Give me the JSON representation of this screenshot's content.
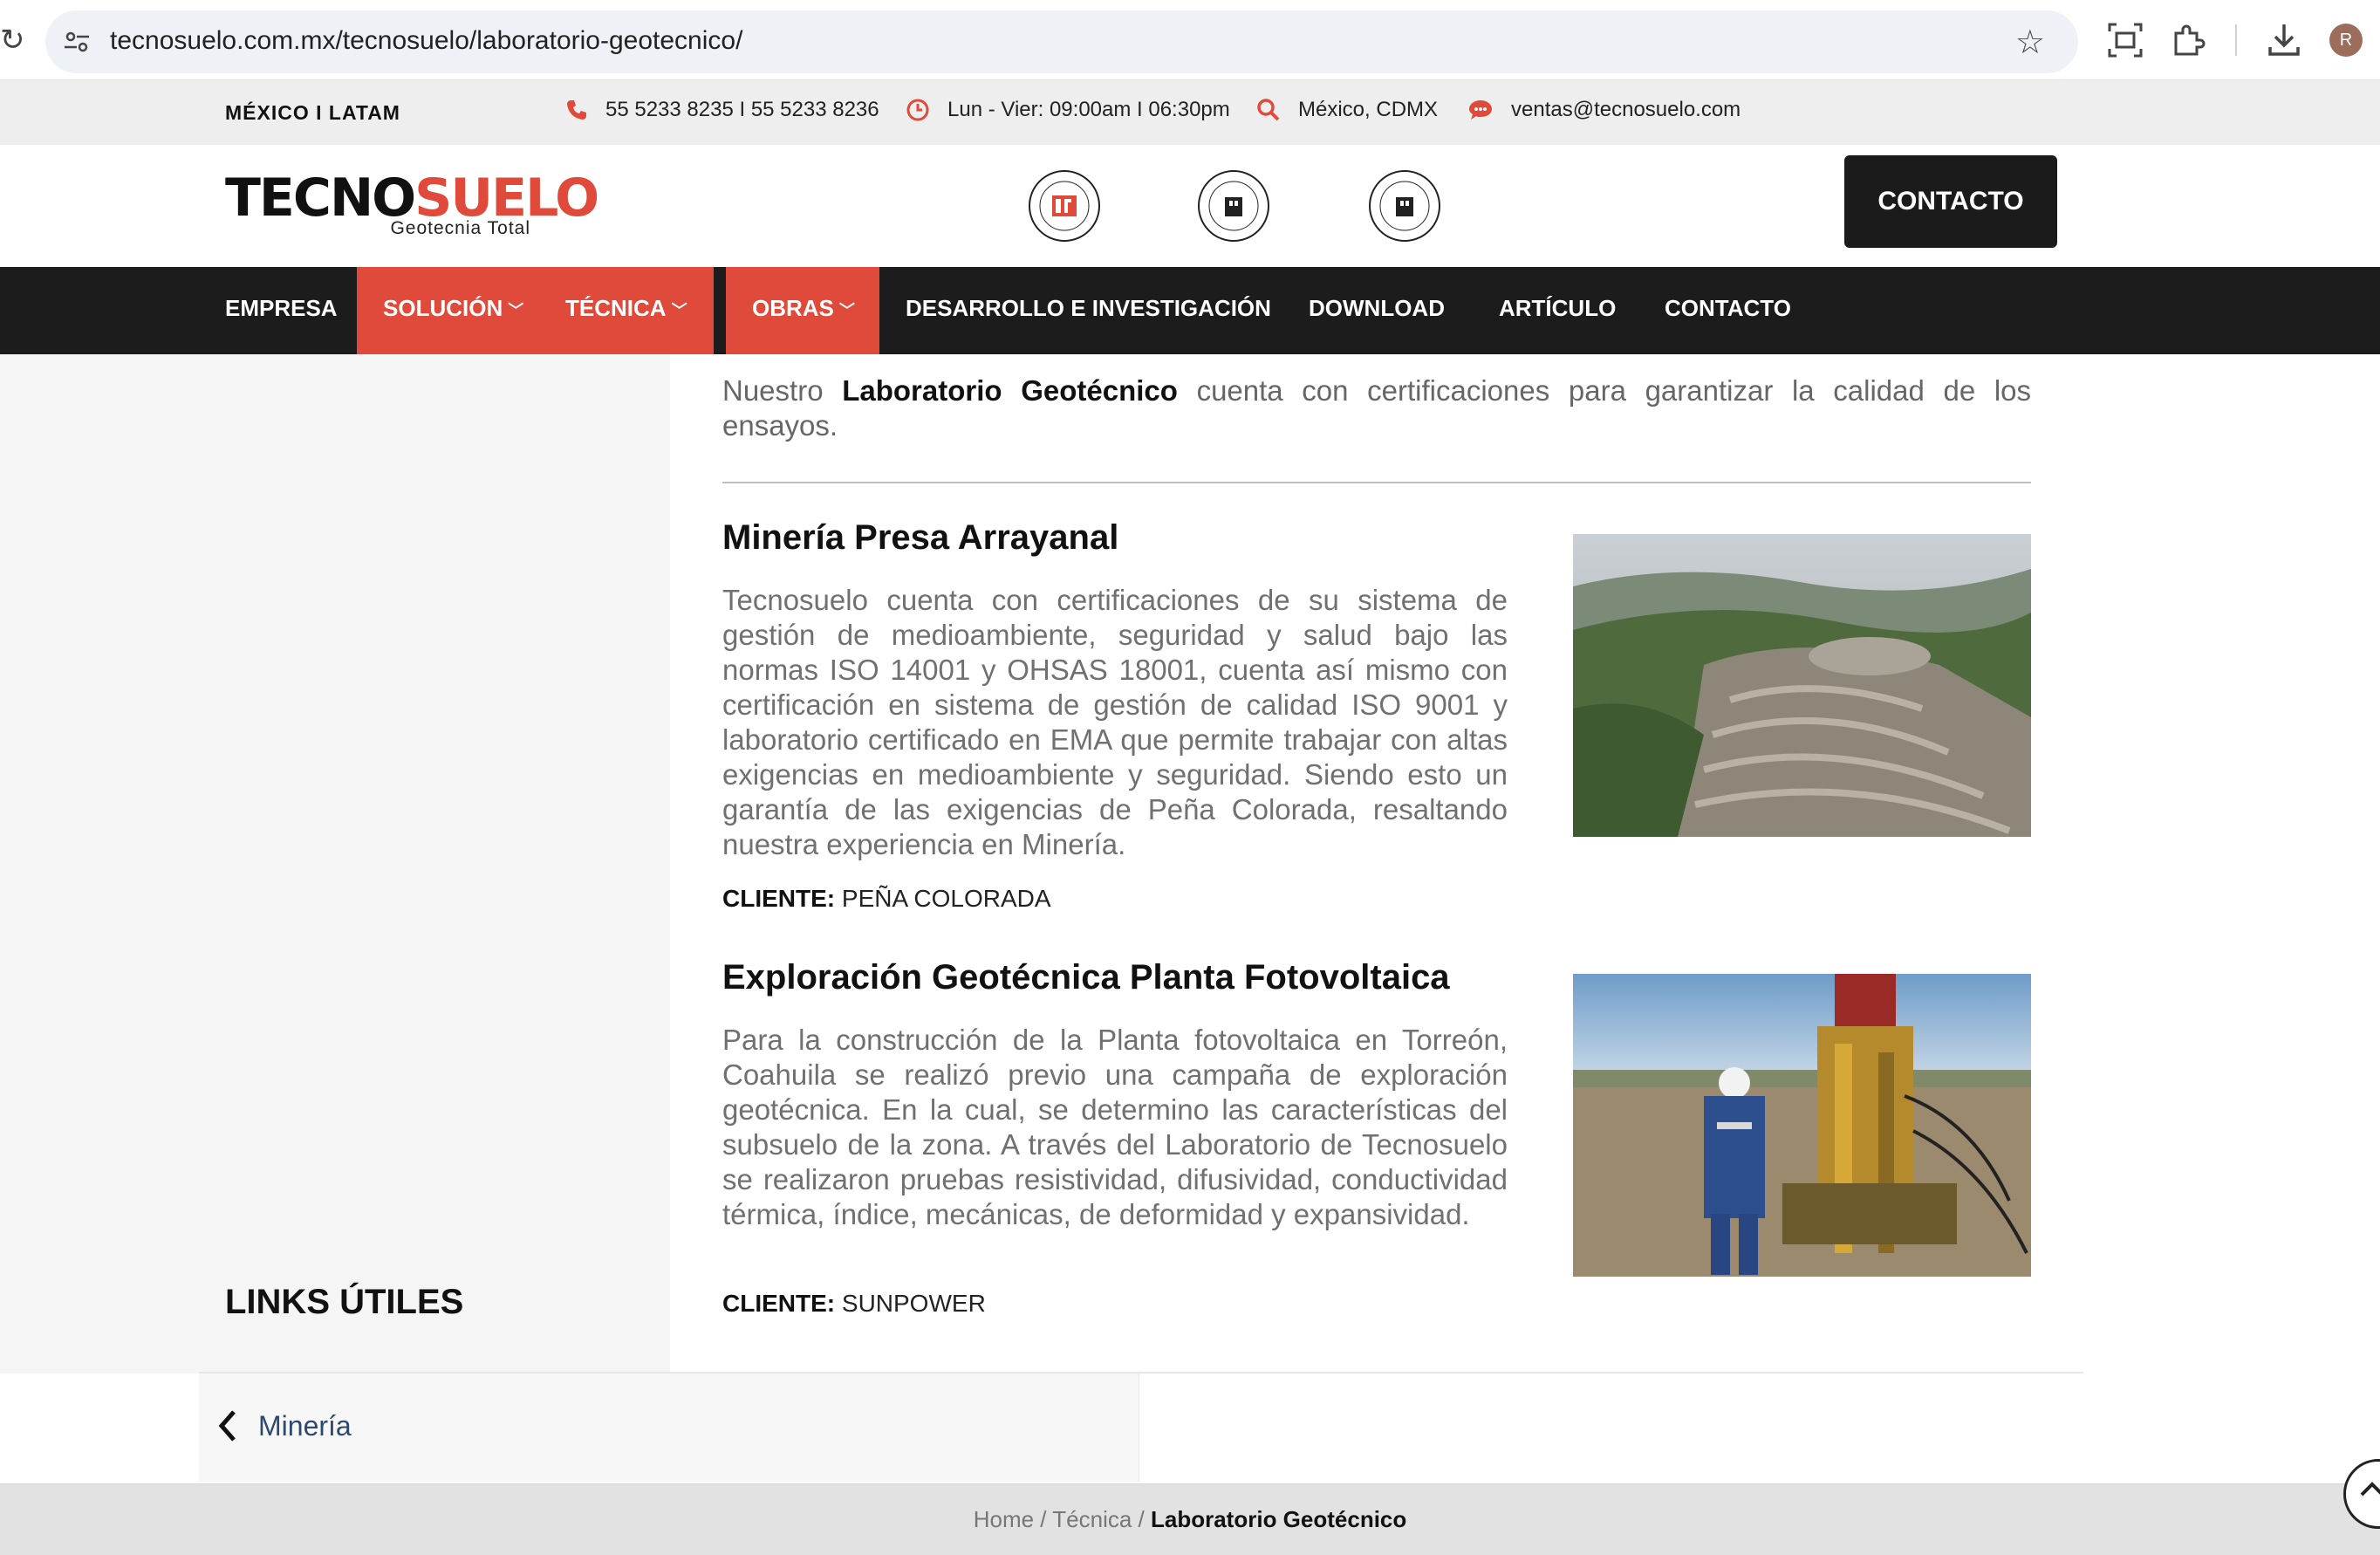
{
  "browser": {
    "url": "tecnosuelo.com.mx/tecnosuelo/laboratorio-geotecnico/",
    "profile_initial": "R"
  },
  "topbar": {
    "region": "MÉXICO I LATAM",
    "phone": "55 5233 8235 I 55 5233 8236",
    "hours": "Lun - Vier: 09:00am I 06:30pm",
    "location": "México, CDMX",
    "email": "ventas@tecnosuelo.com"
  },
  "header": {
    "logo_tec": "TECNO",
    "logo_suelo": "SUELO",
    "logo_sub": "Geotecnia Total",
    "contact_label": "CONTACTO"
  },
  "nav": {
    "items": [
      {
        "label": "EMPRESA"
      },
      {
        "label": "SOLUCIÓN"
      },
      {
        "label": "TÉCNICA"
      },
      {
        "label": "OBRAS"
      },
      {
        "label": "DESARROLLO E INVESTIGACIÓN"
      },
      {
        "label": "DOWNLOAD"
      },
      {
        "label": "ARTÍCULO"
      },
      {
        "label": "CONTACTO"
      }
    ]
  },
  "intro": {
    "prefix": "Nuestro",
    "bold": "Laboratorio Geotécnico",
    "suffix": "cuenta con certificaciones para garantizar la calidad de los ensayos."
  },
  "projects": [
    {
      "title": "Minería Presa Arrayanal",
      "description": "Tecnosuelo cuenta con certificaciones de su sistema de gestión de medioambiente, seguridad y salud bajo las normas ISO 14001 y OHSAS 18001, cuenta así mismo con certificación en sistema de gestión de calidad ISO 9001 y laboratorio certificado en EMA que permite trabajar con altas exigencias en medioambiente y seguridad. Siendo esto un garantía de las exigencias de Peña Colorada, resaltando nuestra experiencia en Minería.",
      "client_label": "CLIENTE:",
      "client": "PEÑA COLORADA"
    },
    {
      "title": "Exploración Geotécnica Planta Fotovoltaica",
      "description": "Para la construcción de la Planta fotovoltaica en Torreón, Coahuila se realizó previo una campaña de exploración geotécnica.  En la cual, se determino las características del subsuelo de la zona. A través del Laboratorio de Tecnosuelo se realizaron pruebas resistividad, difusividad, conductividad térmica, índice, mecánicas, de deformidad y expansividad.",
      "client_label": "CLIENTE:",
      "client": "SUNPOWER"
    }
  ],
  "sidebar": {
    "links_title": "LINKS ÚTILES"
  },
  "post_nav": {
    "prev_label": "Minería"
  },
  "breadcrumb": {
    "home": "Home",
    "sep": " / ",
    "section": "Técnica",
    "current": "Laboratorio Geotécnico"
  },
  "colors": {
    "accent": "#e04a3a",
    "nav_bg": "#1c1c1c"
  }
}
